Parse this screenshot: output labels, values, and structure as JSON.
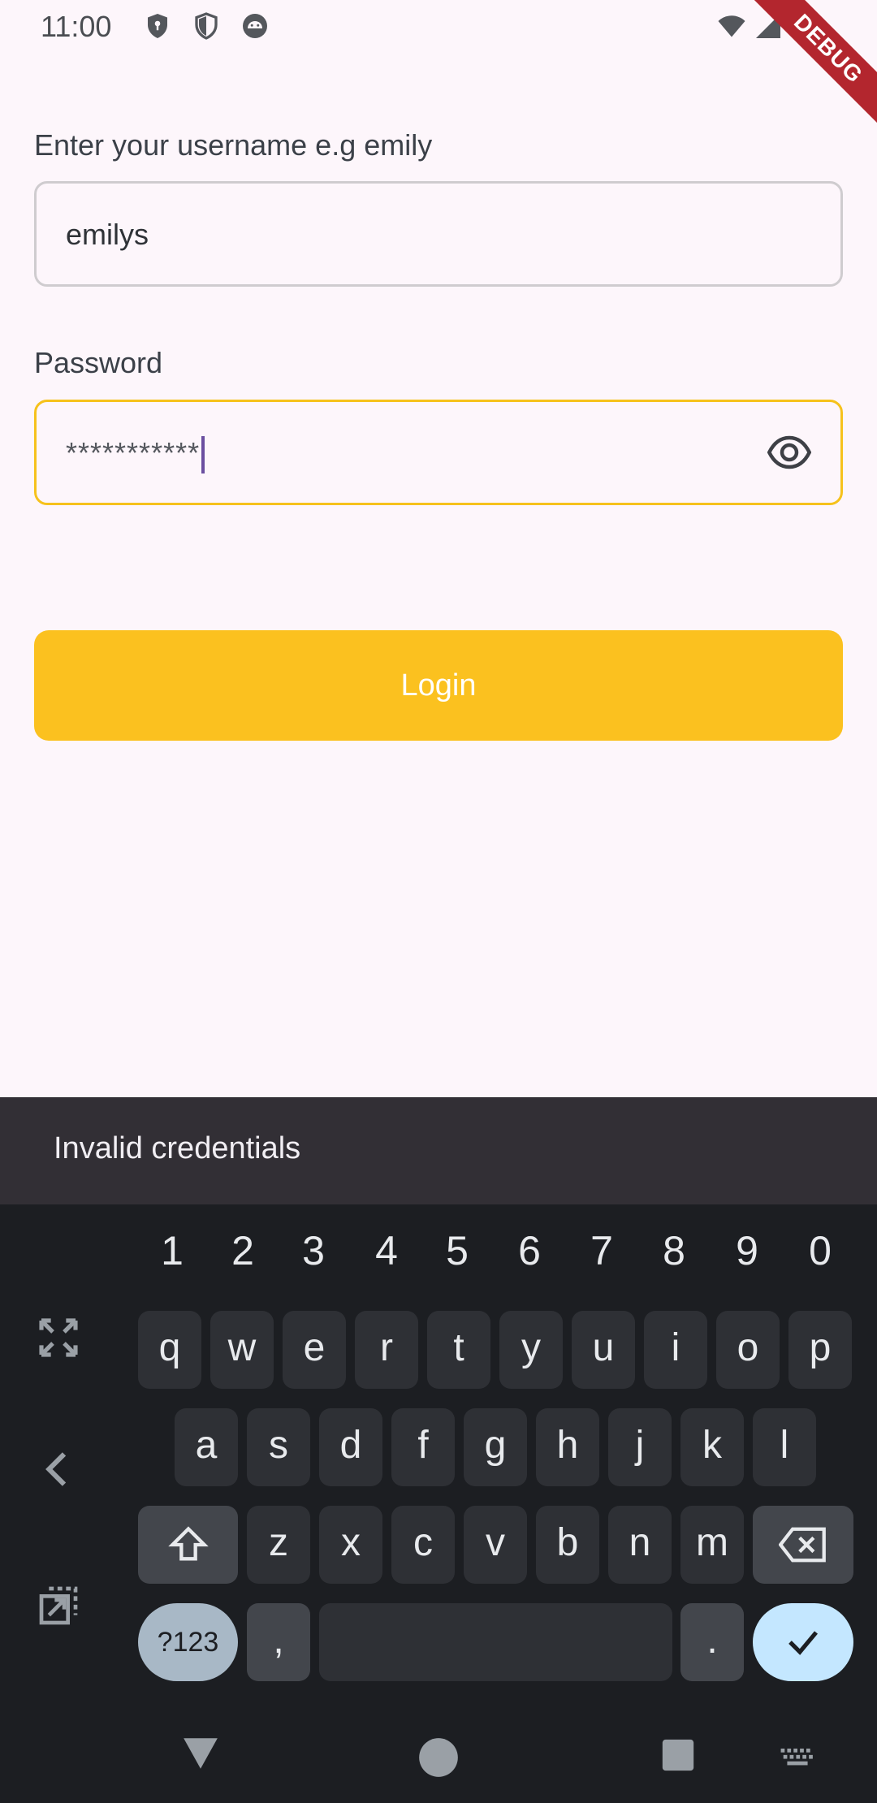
{
  "status_bar": {
    "time": "11:00",
    "icons": [
      "shield-key-icon",
      "shield-icon",
      "android-icon",
      "wifi-icon",
      "signal-icon",
      "battery-icon"
    ],
    "debug_label": "DEBUG"
  },
  "form": {
    "username_label": "Enter your username e.g emily",
    "username_value": "emilys",
    "password_label": "Password",
    "password_value": "***********",
    "login_label": "Login"
  },
  "snackbar": {
    "message": "Invalid credentials"
  },
  "keyboard": {
    "numbers": [
      "1",
      "2",
      "3",
      "4",
      "5",
      "6",
      "7",
      "8",
      "9",
      "0"
    ],
    "row1": [
      "q",
      "w",
      "e",
      "r",
      "t",
      "y",
      "u",
      "i",
      "o",
      "p"
    ],
    "row2": [
      "a",
      "s",
      "d",
      "f",
      "g",
      "h",
      "j",
      "k",
      "l"
    ],
    "row3": [
      "z",
      "x",
      "c",
      "v",
      "b",
      "n",
      "m"
    ],
    "symbols_label": "?123",
    "comma": ",",
    "period": "."
  },
  "colors": {
    "accent": "#fbc11f",
    "background": "#fdf6fb",
    "snackbar": "#322f35",
    "keyboard": "#1c1e22"
  }
}
